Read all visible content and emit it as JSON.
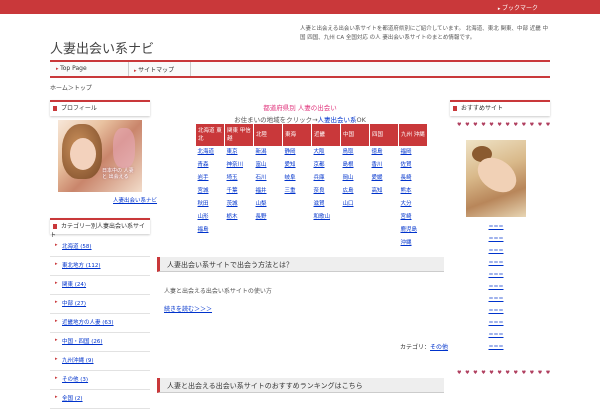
{
  "header": {
    "bookmark": "ブックマーク",
    "site_title": "人妻出会い系ナビ",
    "description": "人妻と出会える出会い系サイトを都道府県別にご紹介しています。 北海道、東北 関東、中部 近畿 中国 四国、九州 CA 全国対応 の人 妻出会い系サイトのまとめ情報です。"
  },
  "nav": {
    "items": [
      "Top Page",
      "サイトマップ"
    ]
  },
  "breadcrumb": "ホーム＞トップ",
  "left_sidebar": {
    "profile_title": "プロフィール",
    "profile_caption": "日本中の 人妻と 出会える",
    "profile_link": "人妻出会い系ナビ",
    "categories_title": "カテゴリー別人妻出会い系サイト",
    "categories": [
      {
        "label": "北海道 (58)"
      },
      {
        "label": "東北地方 (112)"
      },
      {
        "label": "関東 (24)"
      },
      {
        "label": "中部 (27)"
      },
      {
        "label": "近畿地方の人妻 (63)"
      },
      {
        "label": "中国・四国 (26)"
      },
      {
        "label": "九州沖縄 (9)"
      },
      {
        "label": "その他 (3)"
      },
      {
        "label": "全国 (2)"
      }
    ]
  },
  "main": {
    "top_line1": "都道府県別 人妻の出会い",
    "top_line2_prefix": "お住まいの地域をクリック→",
    "top_line2_link": "人妻出会い系",
    "top_line2_suffix": "OK",
    "regions": [
      "北海道 東北",
      "関東 甲信越",
      "北陸",
      "東海",
      "近畿",
      "中国",
      "四国",
      "九州 沖縄"
    ],
    "prefectures": [
      [
        "北海道",
        "青森",
        "岩手",
        "宮城",
        "秋田",
        "山形",
        "福島"
      ],
      [
        "東京",
        "神奈川",
        "埼玉",
        "千葉",
        "茨城",
        "栃木"
      ],
      [
        "新潟",
        "富山",
        "石川",
        "福井",
        "山梨",
        "長野"
      ],
      [
        "静岡",
        "愛知",
        "岐阜",
        "三重"
      ],
      [
        "大阪",
        "京都",
        "兵庫",
        "奈良",
        "滋賀",
        "和歌山"
      ],
      [
        "鳥取",
        "島根",
        "岡山",
        "広島",
        "山口"
      ],
      [
        "徳島",
        "香川",
        "愛媛",
        "高知"
      ],
      [
        "福岡",
        "佐賀",
        "長崎",
        "熊本",
        "大分",
        "宮崎",
        "鹿児島",
        "沖縄"
      ]
    ],
    "section1_title": "人妻出会い系サイトで出会う方法とは？",
    "section1_text": "人妻と出会える出会い系サイトの使い方",
    "section1_link": "続きを読む＞＞＞",
    "category_label": "カテゴリ：",
    "category_link": "その他",
    "section2_title": "人妻と出会える出会い系サイトのおすすめランキングはこちら"
  },
  "right_sidebar": {
    "title": "おすすめサイト",
    "hearts": "♥ ♥ ♥ ♥ ♥ ♥ ♥ ♥ ♥ ♥ ♥ ♥",
    "links": [
      "＝＝＝",
      "＝＝＝",
      "＝＝＝",
      "＝＝＝",
      "＝＝＝",
      "＝＝＝",
      "＝＝＝",
      "＝＝＝",
      "＝＝＝",
      "＝＝＝",
      "＝＝＝"
    ],
    "hearts_bottom": "♥ ♥ ♥ ♥ ♥ ♥ ♥ ♥ ♥ ♥ ♥ ♥"
  },
  "colors": {
    "accent": "#c9383a",
    "pink": "#e0347c",
    "link": "#0033cc"
  }
}
